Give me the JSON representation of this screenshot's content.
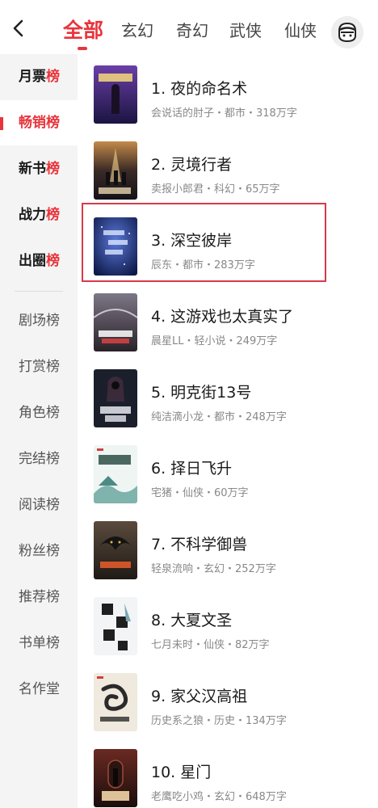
{
  "nav": {
    "tabs": [
      {
        "label": "全部",
        "active": true
      },
      {
        "label": "玄幻"
      },
      {
        "label": "奇幻"
      },
      {
        "label": "武侠"
      },
      {
        "label": "仙侠"
      }
    ]
  },
  "sidebar": {
    "items": [
      {
        "label_a": "月票",
        "label_b": "榜"
      },
      {
        "label": "畅销榜",
        "active": true
      },
      {
        "label_a": "新书",
        "label_b": "榜"
      },
      {
        "label_a": "战力",
        "label_b": "榜"
      },
      {
        "label_a": "出圈",
        "label_b": "榜"
      },
      {
        "label": "剧场榜"
      },
      {
        "label": "打赏榜"
      },
      {
        "label": "角色榜"
      },
      {
        "label": "完结榜"
      },
      {
        "label": "阅读榜"
      },
      {
        "label": "粉丝榜"
      },
      {
        "label": "推荐榜"
      },
      {
        "label": "书单榜"
      },
      {
        "label": "名作堂"
      }
    ]
  },
  "books": [
    {
      "title": "1. 夜的命名术",
      "meta": "会说话的肘子・都市・318万字",
      "cover_color": "#3a2a6a"
    },
    {
      "title": "2. 灵境行者",
      "meta": "卖报小郎君・科幻・65万字",
      "cover_color": "#2a2a3a"
    },
    {
      "title": "3. 深空彼岸",
      "meta": "辰东・都市・283万字",
      "cover_color": "#1d2f7a",
      "highlighted": true
    },
    {
      "title": "4. 这游戏也太真实了",
      "meta": "晨星LL・轻小说・249万字",
      "cover_color": "#3a3540"
    },
    {
      "title": "5. 明克街13号",
      "meta": "纯洁滴小龙・都市・248万字",
      "cover_color": "#1e2330"
    },
    {
      "title": "6. 择日飞升",
      "meta": "宅猪・仙侠・60万字",
      "cover_color": "#b9d7d4"
    },
    {
      "title": "7. 不科学御兽",
      "meta": "轻泉流响・玄幻・252万字",
      "cover_color": "#3b3128"
    },
    {
      "title": "8. 大夏文圣",
      "meta": "七月未时・仙侠・82万字",
      "cover_color": "#e8ecef"
    },
    {
      "title": "9. 家父汉高祖",
      "meta": "历史系之狼・历史・134万字",
      "cover_color": "#ece6da"
    },
    {
      "title": "10. 星门",
      "meta": "老鹰吃小鸡・玄幻・648万字",
      "cover_color": "#3a2320"
    }
  ]
}
